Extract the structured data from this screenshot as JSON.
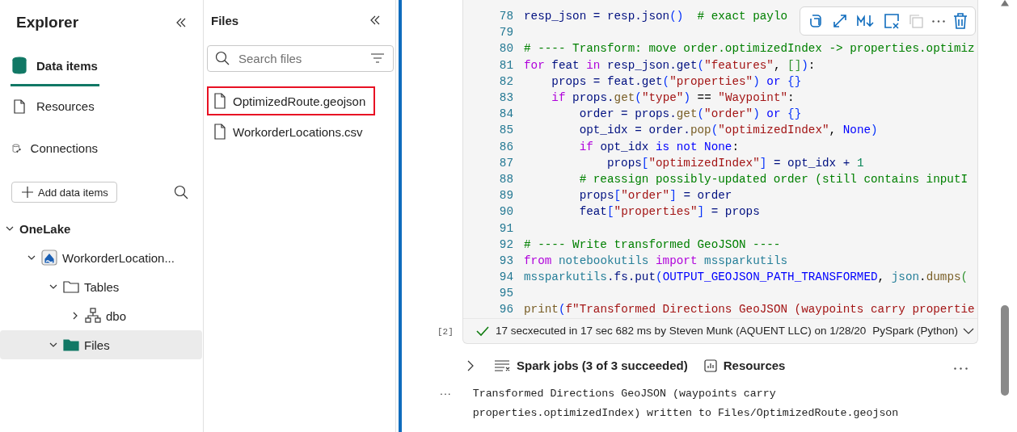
{
  "explorer": {
    "title": "Explorer",
    "nav": [
      {
        "label": "Data items",
        "kind": "data",
        "selected": true
      },
      {
        "label": "Resources",
        "kind": "resources",
        "selected": false
      },
      {
        "label": "Connections",
        "kind": "connections",
        "selected": false
      }
    ],
    "add_button": "Add data items",
    "tree": [
      {
        "label": "OneLake",
        "kind": "root",
        "expanded": true,
        "selected": false,
        "children": [
          {
            "label": "WorkorderLocation...",
            "kind": "lakehouse",
            "expanded": true,
            "selected": false,
            "children": [
              {
                "label": "Tables",
                "kind": "folder",
                "expanded": true,
                "selected": false,
                "children": [
                  {
                    "label": "dbo",
                    "kind": "schema",
                    "expanded": false,
                    "selected": false
                  }
                ]
              },
              {
                "label": "Files",
                "kind": "files",
                "expanded": true,
                "selected": true
              }
            ]
          }
        ]
      }
    ]
  },
  "files_panel": {
    "title": "Files",
    "search": {
      "placeholder": "Search files"
    },
    "files": [
      {
        "name": "OptimizedRoute.geojson",
        "highlighted": true
      },
      {
        "name": "WorkorderLocations.csv",
        "highlighted": false
      }
    ]
  },
  "notebook": {
    "cell": {
      "lines": [
        {
          "number": "78",
          "tokens": [
            {
              "text": "resp_json = resp.json",
              "kind": "variable"
            },
            {
              "text": "()",
              "kind": "bracket"
            },
            {
              "text": "  # exact paylo",
              "kind": "comment"
            }
          ]
        },
        {
          "number": "79"
        },
        {
          "number": "80",
          "tokens": [
            {
              "text": "# ---- Transform: move order.optimizedIndex -> properties.optimiz",
              "kind": "comment"
            }
          ]
        },
        {
          "number": "81",
          "tokens": [
            {
              "text": "for",
              "kind": "keyword"
            },
            {
              "text": " feat ",
              "kind": "variable"
            },
            {
              "text": "in",
              "kind": "keyword"
            },
            {
              "text": " resp_json.get",
              "kind": "variable"
            },
            {
              "text": "(",
              "kind": "bracket"
            },
            {
              "text": "\"features\"",
              "kind": "string"
            },
            {
              "text": ", ",
              "kind": "plain"
            },
            {
              "text": "[]",
              "kind": "bracket2"
            },
            {
              "text": ")",
              "kind": "bracket"
            },
            {
              "text": ":",
              "kind": "plain"
            }
          ]
        },
        {
          "number": "82",
          "tokens": [
            {
              "text": "    props = feat.get",
              "kind": "variable"
            },
            {
              "text": "(",
              "kind": "bracket"
            },
            {
              "text": "\"properties\"",
              "kind": "string"
            },
            {
              "text": ")",
              "kind": "bracket"
            },
            {
              "text": " or",
              "kind": "constant"
            },
            {
              "text": " {}",
              "kind": "bracket"
            }
          ]
        },
        {
          "number": "83",
          "tokens": [
            {
              "text": "    if",
              "kind": "keyword"
            },
            {
              "text": " props.",
              "kind": "variable"
            },
            {
              "text": "get",
              "kind": "function"
            },
            {
              "text": "(",
              "kind": "bracket"
            },
            {
              "text": "\"type\"",
              "kind": "string"
            },
            {
              "text": ")",
              "kind": "bracket"
            },
            {
              "text": " == ",
              "kind": "plain"
            },
            {
              "text": "\"Waypoint\"",
              "kind": "string"
            },
            {
              "text": ":",
              "kind": "plain"
            }
          ]
        },
        {
          "number": "84",
          "tokens": [
            {
              "text": "        order = props.",
              "kind": "variable"
            },
            {
              "text": "get",
              "kind": "function"
            },
            {
              "text": "(",
              "kind": "bracket"
            },
            {
              "text": "\"order\"",
              "kind": "string"
            },
            {
              "text": ")",
              "kind": "bracket"
            },
            {
              "text": " or",
              "kind": "constant"
            },
            {
              "text": " {}",
              "kind": "bracket"
            }
          ]
        },
        {
          "number": "85",
          "tokens": [
            {
              "text": "        opt_idx = order.",
              "kind": "variable"
            },
            {
              "text": "pop",
              "kind": "function"
            },
            {
              "text": "(",
              "kind": "bracket"
            },
            {
              "text": "\"optimizedIndex\"",
              "kind": "string"
            },
            {
              "text": ", ",
              "kind": "plain"
            },
            {
              "text": "None",
              "kind": "constant"
            },
            {
              "text": ")",
              "kind": "bracket"
            }
          ]
        },
        {
          "number": "86",
          "tokens": [
            {
              "text": "        if",
              "kind": "keyword"
            },
            {
              "text": " opt_idx ",
              "kind": "variable"
            },
            {
              "text": "is not None",
              "kind": "constant"
            },
            {
              "text": ":",
              "kind": "plain"
            }
          ]
        },
        {
          "number": "87",
          "tokens": [
            {
              "text": "            props",
              "kind": "variable"
            },
            {
              "text": "[",
              "kind": "bracket"
            },
            {
              "text": "\"optimizedIndex\"",
              "kind": "string"
            },
            {
              "text": "]",
              "kind": "bracket"
            },
            {
              "text": " = opt_idx + ",
              "kind": "variable"
            },
            {
              "text": "1",
              "kind": "number"
            }
          ]
        },
        {
          "number": "88",
          "tokens": [
            {
              "text": "        # reassign possibly-updated order (still contains inputI",
              "kind": "comment"
            }
          ]
        },
        {
          "number": "89",
          "tokens": [
            {
              "text": "        props",
              "kind": "variable"
            },
            {
              "text": "[",
              "kind": "bracket"
            },
            {
              "text": "\"order\"",
              "kind": "string"
            },
            {
              "text": "]",
              "kind": "bracket"
            },
            {
              "text": " = order",
              "kind": "variable"
            }
          ]
        },
        {
          "number": "90",
          "tokens": [
            {
              "text": "        feat",
              "kind": "variable"
            },
            {
              "text": "[",
              "kind": "bracket"
            },
            {
              "text": "\"properties\"",
              "kind": "string"
            },
            {
              "text": "]",
              "kind": "bracket"
            },
            {
              "text": " = props",
              "kind": "variable"
            }
          ]
        },
        {
          "number": "91"
        },
        {
          "number": "92",
          "tokens": [
            {
              "text": "# ---- Write transformed GeoJSON ----",
              "kind": "comment"
            }
          ]
        },
        {
          "number": "93",
          "tokens": [
            {
              "text": "from",
              "kind": "keyword"
            },
            {
              "text": " notebookutils ",
              "kind": "type"
            },
            {
              "text": "import",
              "kind": "keyword"
            },
            {
              "text": " mssparkutils",
              "kind": "type"
            }
          ]
        },
        {
          "number": "94",
          "tokens": [
            {
              "text": "mssparkutils",
              "kind": "type"
            },
            {
              "text": ".fs.put",
              "kind": "variable"
            },
            {
              "text": "(",
              "kind": "bracket"
            },
            {
              "text": "OUTPUT_GEOJSON_PATH_TRANSFORMED",
              "kind": "constant"
            },
            {
              "text": ", ",
              "kind": "plain"
            },
            {
              "text": "json",
              "kind": "type"
            },
            {
              "text": ".",
              "kind": "plain"
            },
            {
              "text": "dumps",
              "kind": "function"
            },
            {
              "text": "(",
              "kind": "bracket2"
            }
          ]
        },
        {
          "number": "95"
        },
        {
          "number": "96",
          "tokens": [
            {
              "text": "print",
              "kind": "function"
            },
            {
              "text": "(",
              "kind": "bracket"
            },
            {
              "text": "f\"Transformed Directions GeoJSON (waypoints carry propertie",
              "kind": "string"
            }
          ]
        }
      ],
      "execution_count": "[2]",
      "status_duration": "17 sec",
      "status_text": "xecuted in 17 sec 682 ms by Steven Munk (AQUENT LLC) on 1/28/20",
      "language": "PySpark (Python)"
    },
    "spark_jobs": "Spark jobs (3 of 3 succeeded)",
    "resources": "Resources",
    "output_marker": "...",
    "output_lines": [
      "Transformed Directions GeoJSON (waypoints carry",
      "properties.optimizedIndex) written to Files/OptimizedRoute.geojson"
    ]
  }
}
